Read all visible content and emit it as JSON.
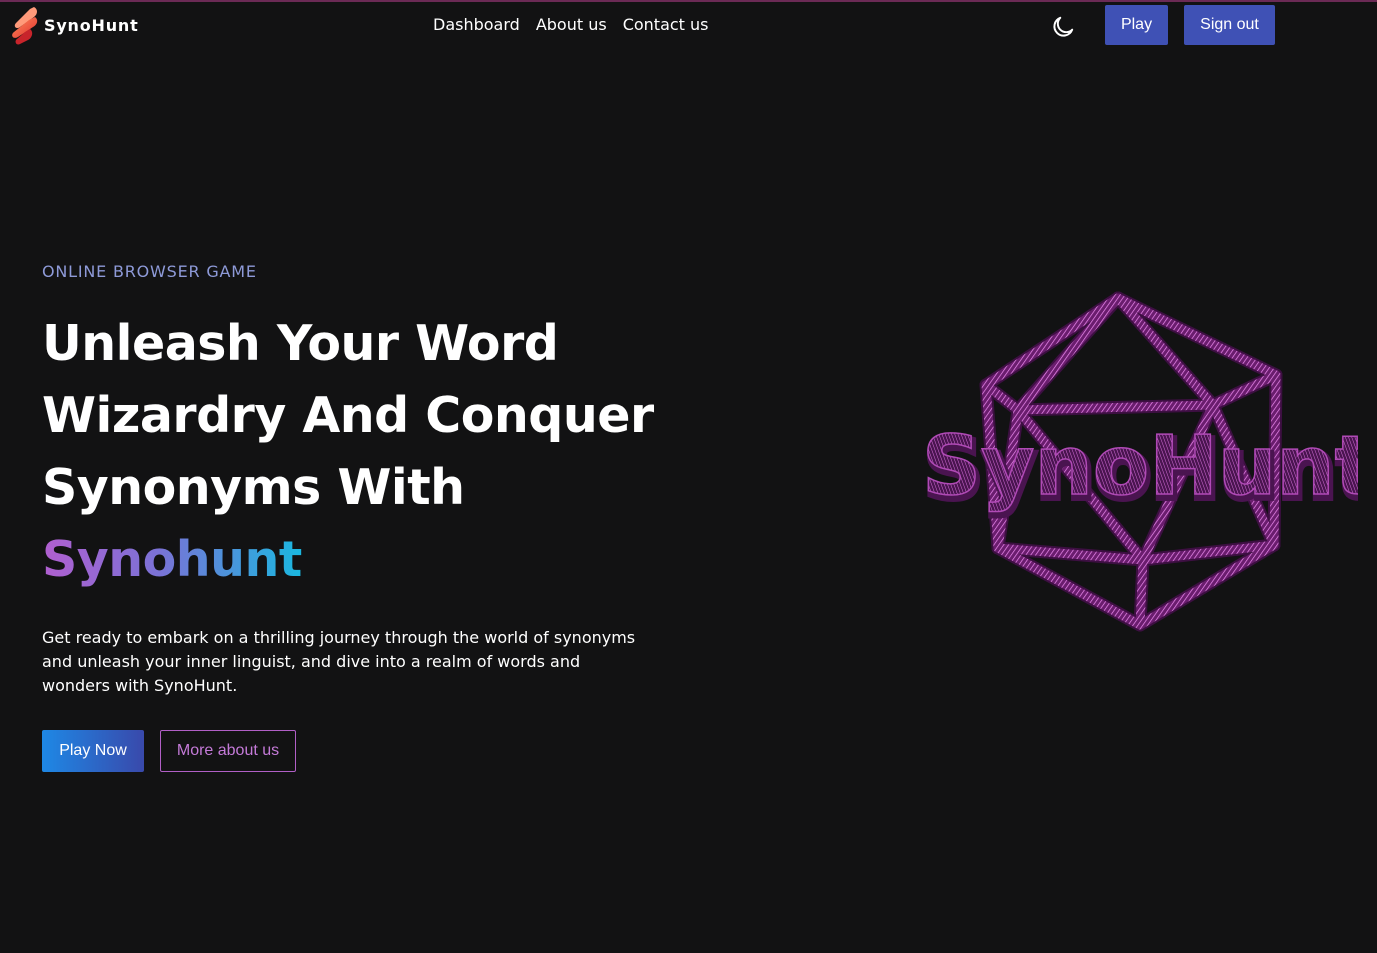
{
  "brand": {
    "name": "SynoHunt",
    "logo_icon": "flame-logo-icon",
    "logo_colors": [
      "#ff6b4a",
      "#e8322f",
      "#b81f2a"
    ]
  },
  "nav": {
    "links": [
      {
        "label": "Dashboard"
      },
      {
        "label": "About us"
      },
      {
        "label": "Contact us"
      }
    ],
    "theme_toggle_icon": "moon-icon",
    "play_label": "Play",
    "signout_label": "Sign out",
    "button_color": "#3f51b5"
  },
  "hero": {
    "eyebrow": "ONLINE BROWSER GAME",
    "headline_line1": "Unleash Your Word",
    "headline_line2": "Wizardry And Conquer",
    "headline_line3_prefix": "Synonyms With ",
    "headline_highlight": "Synohunt",
    "description": "Get ready to embark on a thrilling journey through the world of synonyms and unleash your inner linguist, and dive into a realm of words and wonders with SynoHunt.",
    "play_now_label": "Play Now",
    "more_about_label": "More about us",
    "gradient_colors": [
      "#b15fd0",
      "#1ab8e0"
    ]
  },
  "art": {
    "icon": "d20-dice-icon",
    "text": "SynoHunt",
    "color": "#e07be6"
  }
}
